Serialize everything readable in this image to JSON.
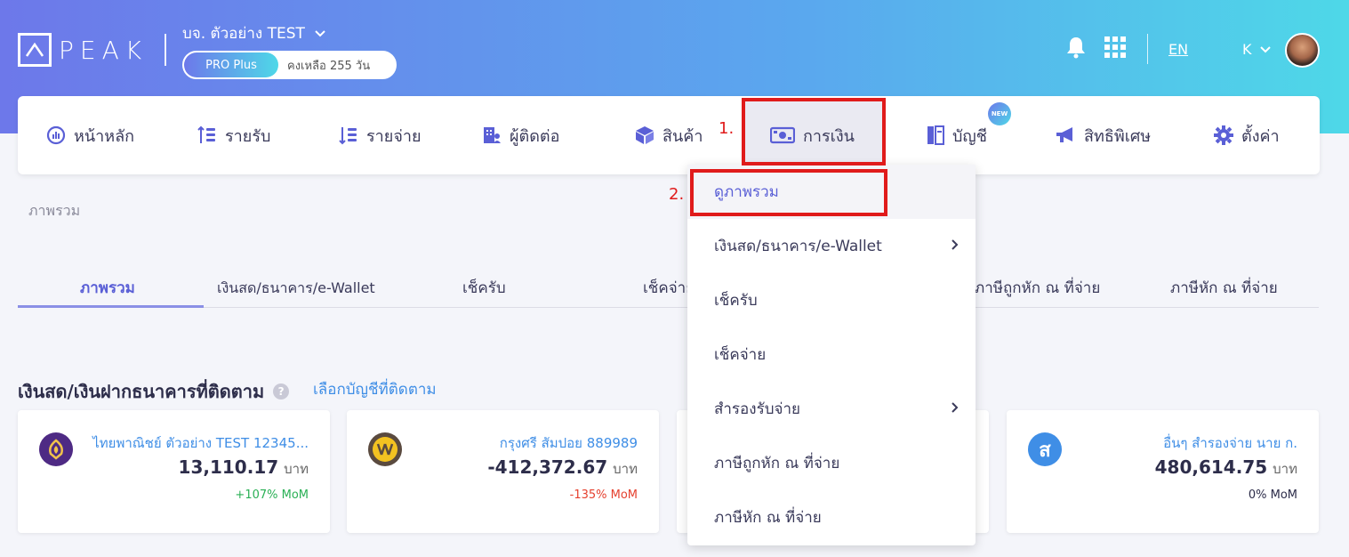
{
  "header": {
    "logo_text": "PEAK",
    "company_name": "บจ. ตัวอย่าง TEST",
    "plan_label": "PRO Plus",
    "plan_days": "คงเหลือ 255 วัน",
    "language": "EN",
    "user_initial": "K",
    "icons": [
      "bell-icon",
      "apps-grid-icon",
      "chevron-down-icon"
    ]
  },
  "nav": {
    "items": [
      {
        "label": "หน้าหลัก",
        "icon": "dashboard-icon"
      },
      {
        "label": "รายรับ",
        "icon": "income-icon"
      },
      {
        "label": "รายจ่าย",
        "icon": "expense-icon"
      },
      {
        "label": "ผู้ติดต่อ",
        "icon": "contacts-icon"
      },
      {
        "label": "สินค้า",
        "icon": "box-icon"
      },
      {
        "label": "การเงิน",
        "icon": "money-icon"
      },
      {
        "label": "บัญชี",
        "icon": "ledger-icon"
      },
      {
        "label": "สิทธิพิเศษ",
        "icon": "megaphone-icon"
      },
      {
        "label": "ตั้งค่า",
        "icon": "gear-icon"
      }
    ],
    "new_badge": "NEW"
  },
  "annotations": {
    "step1": "1.",
    "step2": "2."
  },
  "breadcrumb": "ภาพรวม",
  "tabs": [
    {
      "label": "ภาพรวม",
      "active": true
    },
    {
      "label": "เงินสด/ธนาคาร/e-Wallet"
    },
    {
      "label": "เช็ครับ"
    },
    {
      "label": "เช็คจ่าย"
    },
    {
      "label": "ภาษีถูกหัก ณ ที่จ่าย"
    },
    {
      "label": "ภาษีหัก ณ ที่จ่าย"
    }
  ],
  "section": {
    "title": "เงินสด/เงินฝากธนาคารที่ติดตาม",
    "help": "?",
    "link": "เลือกบัญชีที่ติดตาม"
  },
  "cards": [
    {
      "name": "ไทยพาณิชย์ ตัวอย่าง TEST 12345...",
      "amount": "13,110.17",
      "unit": "บาท",
      "mom": "+107% MoM",
      "color": "#4e2a84",
      "logo": "scb-logo-icon"
    },
    {
      "name": "กรุงศรี สัมปอย 889989",
      "amount": "-412,372.67",
      "unit": "บาท",
      "mom": "-135% MoM",
      "color": "#5a4a3f",
      "logo": "krungsri-logo-icon"
    },
    {
      "name": "",
      "amount": "",
      "unit": "",
      "mom": ""
    },
    {
      "name": "อื่นๆ สำรองจ่าย นาย ก.",
      "amount": "480,614.75",
      "unit": "บาท",
      "mom": "0% MoM",
      "color": "#3f8ee6",
      "logo": "other-logo-icon",
      "logo_letter": "ส"
    }
  ],
  "dropdown": {
    "items": [
      {
        "label": "ดูภาพรวม"
      },
      {
        "label": "เงินสด/ธนาคาร/e-Wallet",
        "submenu": true
      },
      {
        "label": "เช็ครับ"
      },
      {
        "label": "เช็คจ่าย"
      },
      {
        "label": "สำรองรับจ่าย",
        "submenu": true
      },
      {
        "label": "ภาษีถูกหัก ณ ที่จ่าย"
      },
      {
        "label": "ภาษีหัก ณ ที่จ่าย"
      }
    ]
  }
}
